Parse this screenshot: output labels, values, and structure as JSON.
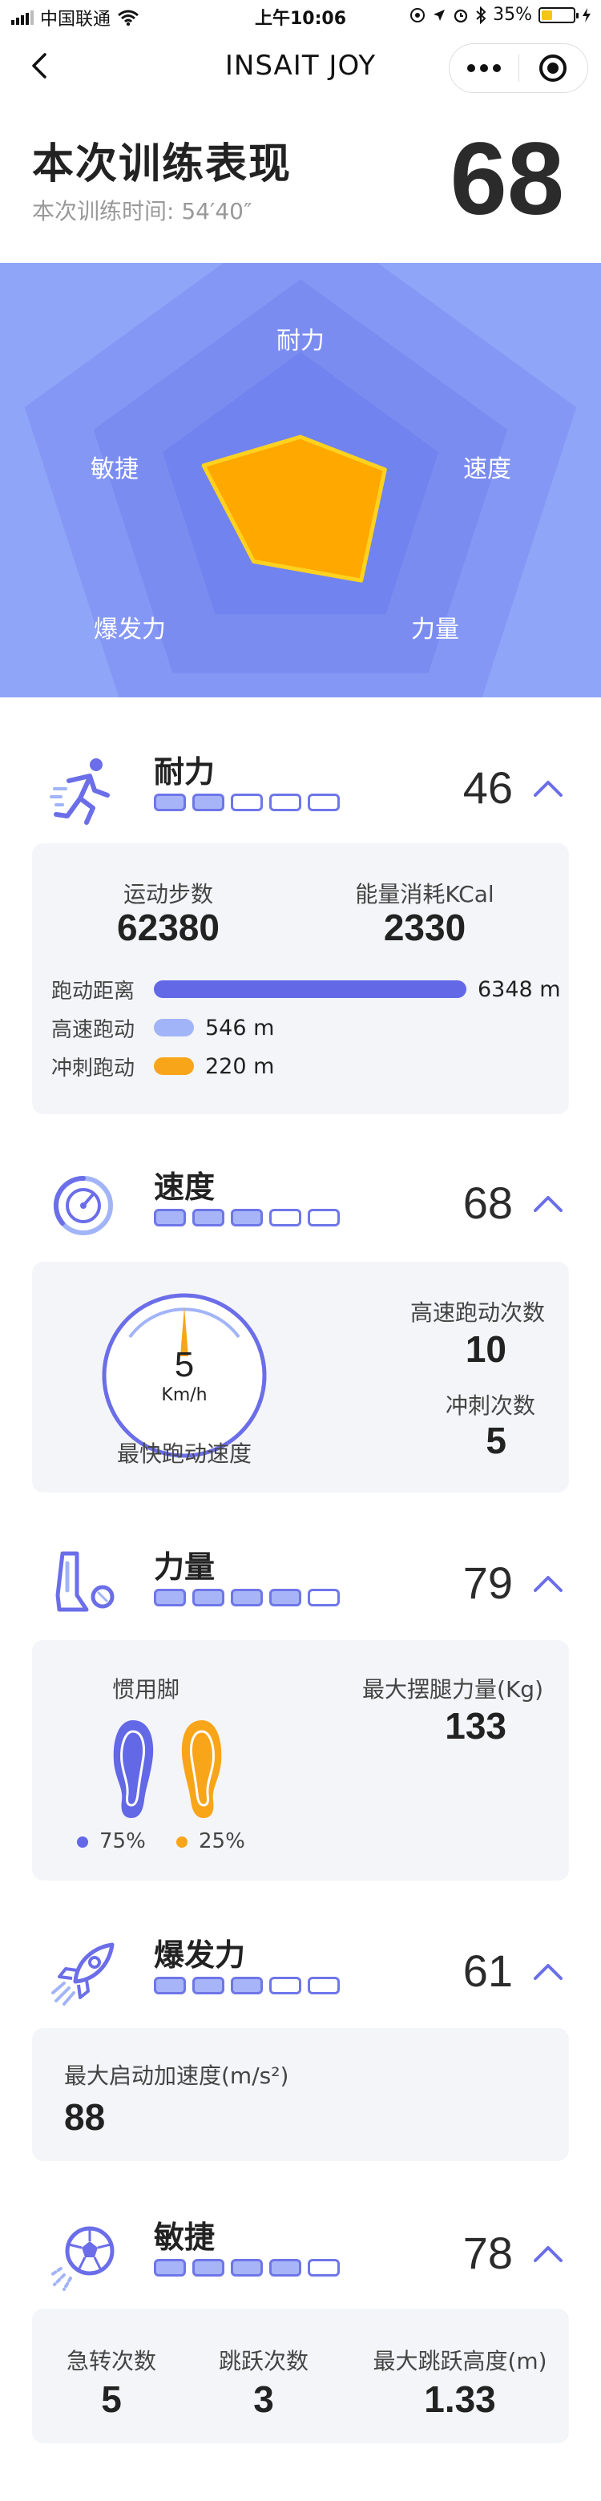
{
  "status_bar": {
    "carrier": "中国联通",
    "time": "上午10:06",
    "battery": "35%",
    "battery_level": 0.35
  },
  "nav": {
    "title": "INSAIT JOY"
  },
  "summary": {
    "title": "本次训练表现",
    "time_label": "本次训练时间: 54′40″",
    "score": "68"
  },
  "radar": {
    "labels": [
      "耐力",
      "速度",
      "力量",
      "爆发力",
      "敏捷"
    ],
    "values": [
      46,
      68,
      79,
      61,
      78
    ],
    "fill_color": "#ffa800",
    "stroke_color": "#ffd21f",
    "bg_color": "#8fa6f8"
  },
  "colors": {
    "accent": "#6b6ee8",
    "light_accent": "#a2b4f8",
    "orange": "#f9a51a"
  },
  "endurance": {
    "name": "耐力",
    "score": "46",
    "level": 2,
    "level_max": 5,
    "steps_label": "运动步数",
    "steps_value": "62380",
    "energy_label": "能量消耗KCal",
    "energy_value": "2330",
    "bars": [
      {
        "label": "跑动距离",
        "value": "6348",
        "unit": "m",
        "fraction": 1.0,
        "color": "#6268e6"
      },
      {
        "label": "高速跑动",
        "value": "546",
        "unit": "m",
        "fraction": 0.086,
        "color": "#a2b4f8"
      },
      {
        "label": "冲刺跑动",
        "value": "220",
        "unit": "m",
        "fraction": 0.035,
        "color": "#f9a51a"
      }
    ]
  },
  "speed": {
    "name": "速度",
    "score": "68",
    "level": 3,
    "level_max": 5,
    "gauge_value": "5",
    "gauge_unit": "Km/h",
    "gauge_label": "最快跑动速度",
    "hs_label": "高速跑动次数",
    "hs_value": "10",
    "sprint_label": "冲刺次数",
    "sprint_value": "5"
  },
  "power": {
    "name": "力量",
    "score": "79",
    "level": 4,
    "level_max": 5,
    "foot_label": "惯用脚",
    "left_pct": "75%",
    "right_pct": "25%",
    "max_label": "最大摆腿力量(Kg)",
    "max_value": "133"
  },
  "explosive": {
    "name": "爆发力",
    "score": "61",
    "level": 3,
    "level_max": 5,
    "accel_label": "最大启动加速度(m/s²)",
    "accel_value": "88"
  },
  "agility": {
    "name": "敏捷",
    "score": "78",
    "level": 4,
    "level_max": 5,
    "turns_label": "急转次数",
    "turns_value": "5",
    "jumps_label": "跳跃次数",
    "jumps_value": "3",
    "height_label": "最大跳跃高度(m)",
    "height_value": "1.33"
  }
}
